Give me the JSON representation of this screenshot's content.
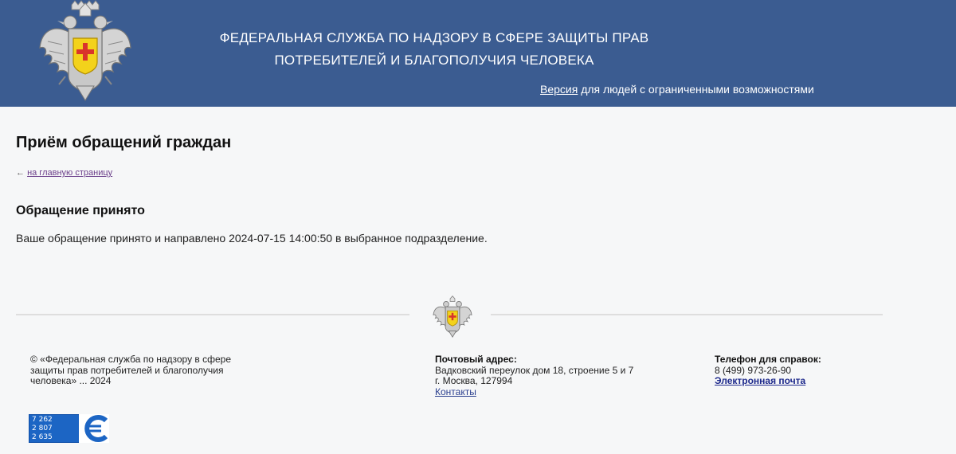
{
  "header": {
    "title_line1": "ФЕДЕРАЛЬНАЯ СЛУЖБА ПО НАДЗОРУ В СФЕРЕ ЗАЩИТЫ ПРАВ",
    "title_line2": "ПОТРЕБИТЕЛЕЙ И БЛАГОПОЛУЧИЯ ЧЕЛОВЕКА",
    "access_link_word": "Версия",
    "access_link_rest": " для людей с ограниченными возможностями"
  },
  "main": {
    "page_title": "Приём обращений граждан",
    "back_arrow": "←",
    "back_link": "на главную страницу",
    "sub_title": "Обращение принято",
    "message": "Ваше обращение принято и направлено 2024-07-15 14:00:50 в выбранное подразделение."
  },
  "footer": {
    "copyright_lines": [
      "© «Федеральная служба по надзору в сфере",
      "защиты прав потребителей и благополучия",
      "человека» ... 2024"
    ],
    "address_label": "Почтовый адрес:",
    "address_lines": [
      "Вадковский переулок дом 18, строение 5 и 7",
      "г. Москва, 127994"
    ],
    "contacts_link": "Контакты",
    "phone_label": "Телефон для справок:",
    "phone": "8 (499) 973-26-90",
    "email_link": "Электронная почта",
    "counter_values": [
      "7 262",
      "2 807",
      "2 635"
    ]
  },
  "colors": {
    "header_bg": "#3b5c91",
    "counter_bg": "#1c65c4",
    "link_color": "#2a3f8f"
  },
  "icons": {
    "emblem": "double-headed-eagle-emblem-icon",
    "counter_logo": "counter-logo-icon"
  }
}
